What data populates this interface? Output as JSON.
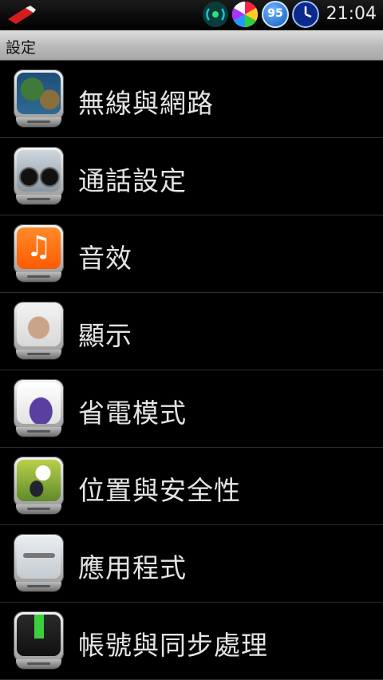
{
  "status_bar": {
    "time": "21:04",
    "battery_level": "95",
    "icons": [
      "usb-icon",
      "wifi-hotspot-icon",
      "color-wheel-icon",
      "battery-icon",
      "clock-icon"
    ]
  },
  "title": "設定",
  "settings_items": [
    {
      "label": "無線與網路",
      "icon": "globe-map-icon"
    },
    {
      "label": "通話設定",
      "icon": "motorcycle-icon"
    },
    {
      "label": "音效",
      "icon": "music-note-icon"
    },
    {
      "label": "顯示",
      "icon": "figure-icon"
    },
    {
      "label": "省電模式",
      "icon": "ink-bottle-icon"
    },
    {
      "label": "位置與安全性",
      "icon": "golf-ball-icon"
    },
    {
      "label": "應用程式",
      "icon": "airplane-icon"
    },
    {
      "label": "帳號與同步處理",
      "icon": "sync-download-icon"
    }
  ]
}
